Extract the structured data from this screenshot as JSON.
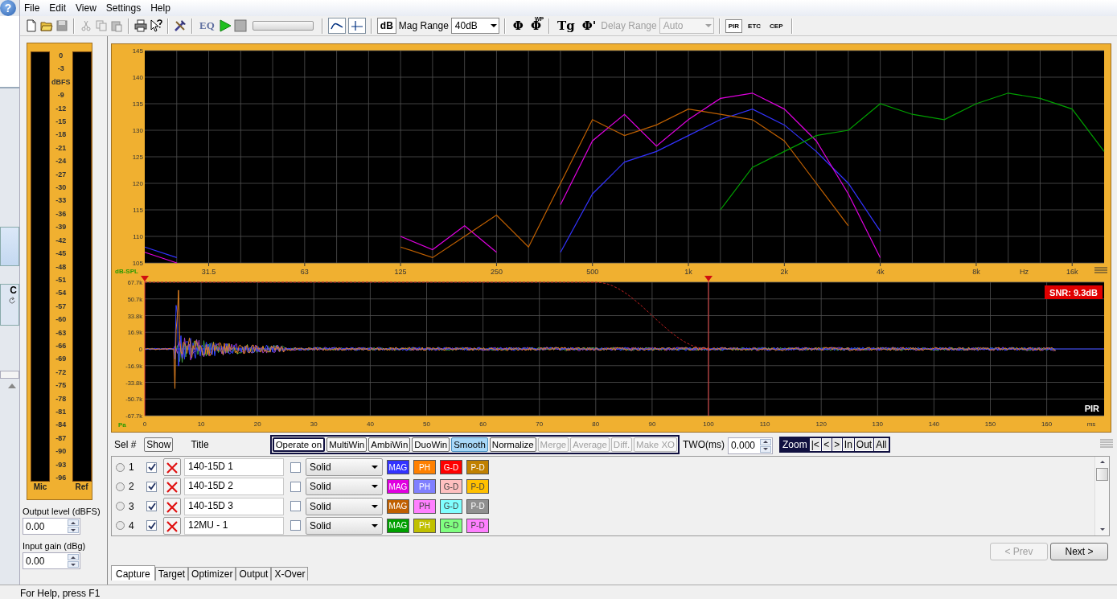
{
  "left_edge": {
    "help_glyph": "?",
    "panel_letter": "C"
  },
  "menu": [
    "File",
    "Edit",
    "View",
    "Settings",
    "Help"
  ],
  "toolbar": {
    "eq": "EQ",
    "db": {
      "label": "dB",
      "pressed": true
    },
    "mag_range_label": "Mag Range",
    "mag_range": "40dB",
    "phase": "Φ",
    "wrapped_phase": {
      "symbol": "Φ",
      "sup": "WP"
    },
    "group_delay": "Tg",
    "phase_delay": "Φ'",
    "delay_range_label": "Delay Range",
    "delay_range": "Auto",
    "delay_disabled": true,
    "playback": {
      "level": 0
    },
    "views": [
      {
        "label": "PIR",
        "selected": true
      },
      {
        "label": "ETC",
        "selected": false
      },
      {
        "label": "CEP",
        "selected": false
      }
    ]
  },
  "meter": {
    "scale": [
      "0",
      "-3",
      "dBFS",
      "-9",
      "-12",
      "-15",
      "-18",
      "-21",
      "-24",
      "-27",
      "-30",
      "-33",
      "-36",
      "-39",
      "-42",
      "-45",
      "-48",
      "-51",
      "-54",
      "-57",
      "-60",
      "-63",
      "-66",
      "-69",
      "-72",
      "-75",
      "-78",
      "-81",
      "-84",
      "-87",
      "-90",
      "-93",
      "-96"
    ],
    "channels": [
      "Mic",
      "Ref"
    ]
  },
  "level_fields": [
    {
      "label": "Output level (dBFS)",
      "value": "0.00"
    },
    {
      "label": "Input gain (dBg)",
      "value": "0.00"
    }
  ],
  "frequency_chart": {
    "chart_data": {
      "type": "line",
      "grid": true,
      "xlabel": "Hz",
      "ylabel": "dB-SPL",
      "ylim": [
        105,
        145
      ],
      "yticks": [
        105,
        110,
        115,
        120,
        125,
        130,
        135,
        140,
        145
      ],
      "categories": [
        null,
        null,
        "31.5",
        null,
        null,
        "63",
        null,
        null,
        "125",
        null,
        null,
        "250",
        null,
        null,
        "500",
        null,
        null,
        "1k",
        null,
        null,
        "2k",
        null,
        null,
        "4k",
        null,
        null,
        "8k",
        null,
        null,
        "16k",
        null
      ],
      "series": [
        {
          "color": "#3333ff",
          "values": [
            108,
            106,
            null,
            null,
            null,
            null,
            null,
            null,
            null,
            null,
            null,
            null,
            null,
            107,
            118,
            124,
            126,
            129,
            132,
            134,
            131,
            126,
            120,
            111,
            null,
            null,
            null,
            null,
            null,
            null,
            null
          ]
        },
        {
          "color": "#e000e0",
          "values": [
            107,
            105,
            null,
            null,
            null,
            null,
            null,
            null,
            110,
            107.5,
            112,
            107,
            null,
            116,
            128,
            133,
            127,
            132,
            136,
            137,
            134,
            128,
            118,
            106,
            null,
            null,
            null,
            null,
            null,
            null,
            null
          ]
        },
        {
          "color": "#c06000",
          "values": [
            null,
            null,
            null,
            null,
            null,
            null,
            null,
            null,
            108,
            106,
            110,
            114,
            108,
            120,
            132,
            129,
            131,
            134,
            133,
            132,
            128,
            120,
            112,
            null,
            null,
            null,
            null,
            null,
            null,
            null,
            null
          ]
        },
        {
          "color": "#00a000",
          "values": [
            null,
            null,
            null,
            null,
            null,
            null,
            null,
            null,
            null,
            null,
            null,
            null,
            null,
            null,
            null,
            null,
            null,
            null,
            115,
            123,
            126,
            129,
            130,
            135,
            133,
            132,
            135,
            137,
            136,
            134,
            126
          ]
        }
      ]
    }
  },
  "impulse": {
    "y_ticks": [
      "67.7k",
      "50.7k",
      "33.8k",
      "16.9k",
      "0",
      "-16.9k",
      "-33.8k",
      "-50.7k",
      "-67.7k"
    ],
    "x_ticks": [
      "0",
      "10",
      "20",
      "30",
      "40",
      "50",
      "60",
      "70",
      "80",
      "90",
      "100",
      "110",
      "120",
      "130",
      "140",
      "150",
      "160"
    ],
    "y_unit": "Pa",
    "x_unit": "ms",
    "snr": "SNR: 9.3dB",
    "view_label": "PIR"
  },
  "measurements": {
    "headers": {
      "sel": "Sel #",
      "show": "Show",
      "title": "Title"
    },
    "operations": [
      {
        "label": "Operate on",
        "kind": "title",
        "selected": false,
        "disabled": false
      },
      {
        "label": "MultiWin",
        "kind": "button",
        "selected": false,
        "disabled": false
      },
      {
        "label": "AmbiWin",
        "kind": "button",
        "selected": false,
        "disabled": false
      },
      {
        "label": "DuoWin",
        "kind": "button",
        "selected": false,
        "disabled": false
      },
      {
        "label": "Smooth",
        "kind": "button",
        "selected": true,
        "disabled": false
      },
      {
        "label": "Normalize",
        "kind": "button",
        "selected": false,
        "disabled": false
      },
      {
        "label": "Merge",
        "kind": "button",
        "selected": false,
        "disabled": true
      },
      {
        "label": "Average",
        "kind": "button",
        "selected": false,
        "disabled": true
      },
      {
        "label": "Diff.",
        "kind": "button",
        "selected": false,
        "disabled": true
      },
      {
        "label": "Make XO",
        "kind": "button",
        "selected": false,
        "disabled": true
      }
    ],
    "two": {
      "label": "TWO(ms)",
      "value": "0.000"
    },
    "zoom": {
      "label": "Zoom",
      "buttons": [
        "|<",
        "<",
        ">",
        "In",
        "Out",
        "All"
      ]
    },
    "rows": [
      {
        "number": "1",
        "selected": false,
        "shown": true,
        "title": "140-15D 1",
        "checked": false,
        "line_style": "Solid",
        "buttons": [
          {
            "label": "MAG",
            "color": "#3333ff"
          },
          {
            "label": "PH",
            "color": "#ff8000"
          },
          {
            "label": "G-D",
            "color": "#ff0000"
          },
          {
            "label": "P-D",
            "color": "#c08000"
          }
        ]
      },
      {
        "number": "2",
        "selected": false,
        "shown": true,
        "title": "140-15D 2",
        "checked": false,
        "line_style": "Solid",
        "buttons": [
          {
            "label": "MAG",
            "color": "#e000e0"
          },
          {
            "label": "PH",
            "color": "#8080ff"
          },
          {
            "label": "G-D",
            "color": "#ffc0c0"
          },
          {
            "label": "P-D",
            "color": "#ffc000"
          }
        ]
      },
      {
        "number": "3",
        "selected": false,
        "shown": true,
        "title": "140-15D 3",
        "checked": false,
        "line_style": "Solid",
        "buttons": [
          {
            "label": "MAG",
            "color": "#c06000"
          },
          {
            "label": "PH",
            "color": "#ff80ff"
          },
          {
            "label": "G-D",
            "color": "#80ffff"
          },
          {
            "label": "P-D",
            "color": "#909090"
          }
        ]
      },
      {
        "number": "4",
        "selected": false,
        "shown": true,
        "title": "12MU - 1",
        "checked": false,
        "line_style": "Solid",
        "buttons": [
          {
            "label": "MAG",
            "color": "#00a000"
          },
          {
            "label": "PH",
            "color": "#c0c000"
          },
          {
            "label": "G-D",
            "color": "#80ff80"
          },
          {
            "label": "P-D",
            "color": "#ff80ff"
          }
        ]
      }
    ]
  },
  "navigation": {
    "prev": {
      "label": "< Prev",
      "disabled": true
    },
    "next": {
      "label": "Next >",
      "disabled": false
    }
  },
  "tabs": [
    {
      "label": "Capture",
      "selected": true
    },
    {
      "label": "Target",
      "selected": false
    },
    {
      "label": "Optimizer",
      "selected": false
    },
    {
      "label": "Output",
      "selected": false
    },
    {
      "label": "X-Over",
      "selected": false
    }
  ],
  "status_bar": "For Help, press F1"
}
